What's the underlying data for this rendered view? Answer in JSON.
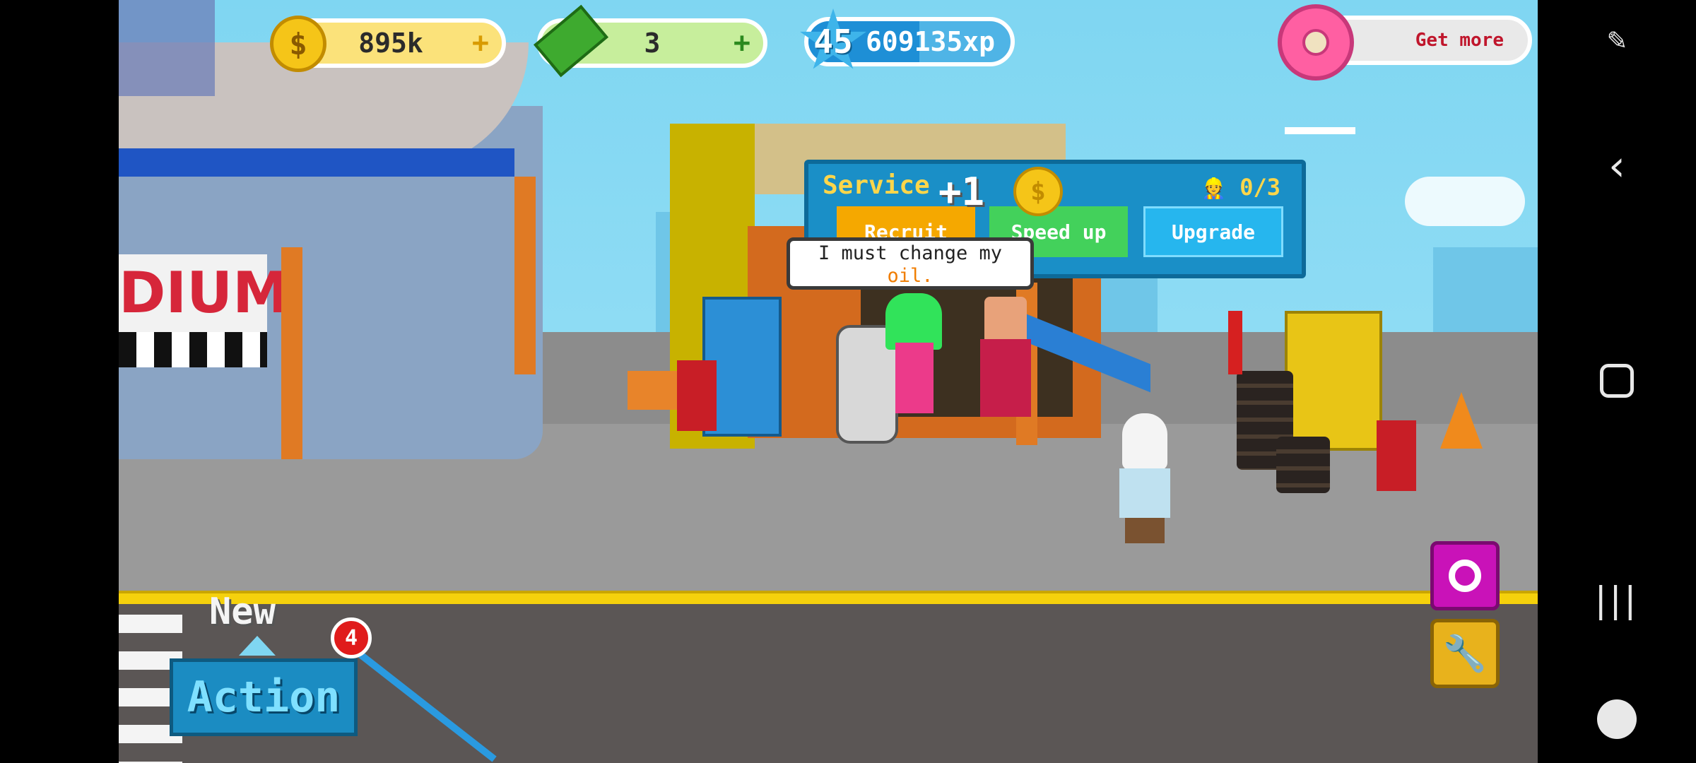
{
  "hud": {
    "coins": "895k",
    "cash": "3",
    "level": "45",
    "xp": "609135xp",
    "xp_progress": 0.55,
    "get_more_label": "Get more",
    "plus_symbol": "+"
  },
  "service": {
    "title": "Service",
    "reward_popup": "+1",
    "workers": "0/3",
    "buttons": {
      "recruit": "Recruit",
      "speed_up": "Speed up",
      "upgrade": "Upgrade"
    }
  },
  "speech": {
    "line1": "I must change my",
    "line2": "oil."
  },
  "stadium_sign": "DIUM",
  "action_panel": {
    "new_label": "New",
    "badge_count": "4",
    "action_label": "Action"
  },
  "colors": {
    "coin": "#f5c518",
    "cash": "#3eaa2f",
    "xp": "#1e8fd6",
    "donut": "#ff5fa2",
    "recruit": "#f5a800",
    "speed_up": "#43d15b",
    "upgrade": "#26b6ee",
    "magenta_button": "#c912b8",
    "wrench_button": "#e8b21c"
  },
  "icons": {
    "coin": "coin-icon",
    "cash": "cash-icon",
    "xp": "xp-star-icon",
    "donut": "donut-icon",
    "worker": "worker-icon",
    "ring": "ring-icon",
    "wrench": "wrench-icon",
    "system_screenshot": "screenshot-tool-icon",
    "system_back": "back-icon",
    "system_home": "home-icon",
    "system_recents": "recents-icon",
    "system_gamepad": "gamepad-icon"
  }
}
